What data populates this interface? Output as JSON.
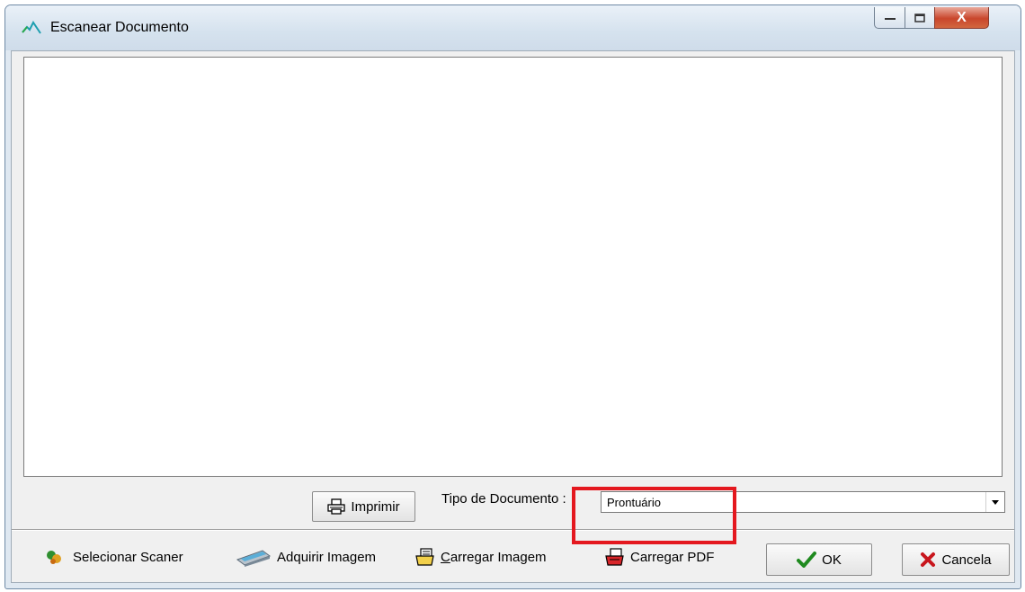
{
  "window": {
    "title": "Escanear Documento",
    "close_glyph": "X"
  },
  "toolbar_top": {
    "print_button": "Imprimir",
    "doc_type_label": "Tipo de Documento :",
    "doc_type_value": "Prontuário"
  },
  "toolbar_bottom": {
    "select_scanner": "Selecionar Scaner",
    "acquire_image": "Adquirir Imagem",
    "load_image_underlined": "C",
    "load_image_rest": "arregar Imagem",
    "load_pdf": "Carregar PDF",
    "ok": "OK",
    "cancel": "Cancela"
  },
  "colors": {
    "highlight": "#e4181f",
    "ok_check": "#1f8a1f",
    "cancel_x": "#c8161d"
  },
  "icons": [
    "app-logo-icon",
    "minimize-icon",
    "maximize-icon",
    "close-icon",
    "printer-icon",
    "dropdown-arrow-icon",
    "scanner-select-icon",
    "scanner-icon",
    "load-image-icon",
    "load-pdf-icon",
    "check-icon",
    "x-icon"
  ]
}
